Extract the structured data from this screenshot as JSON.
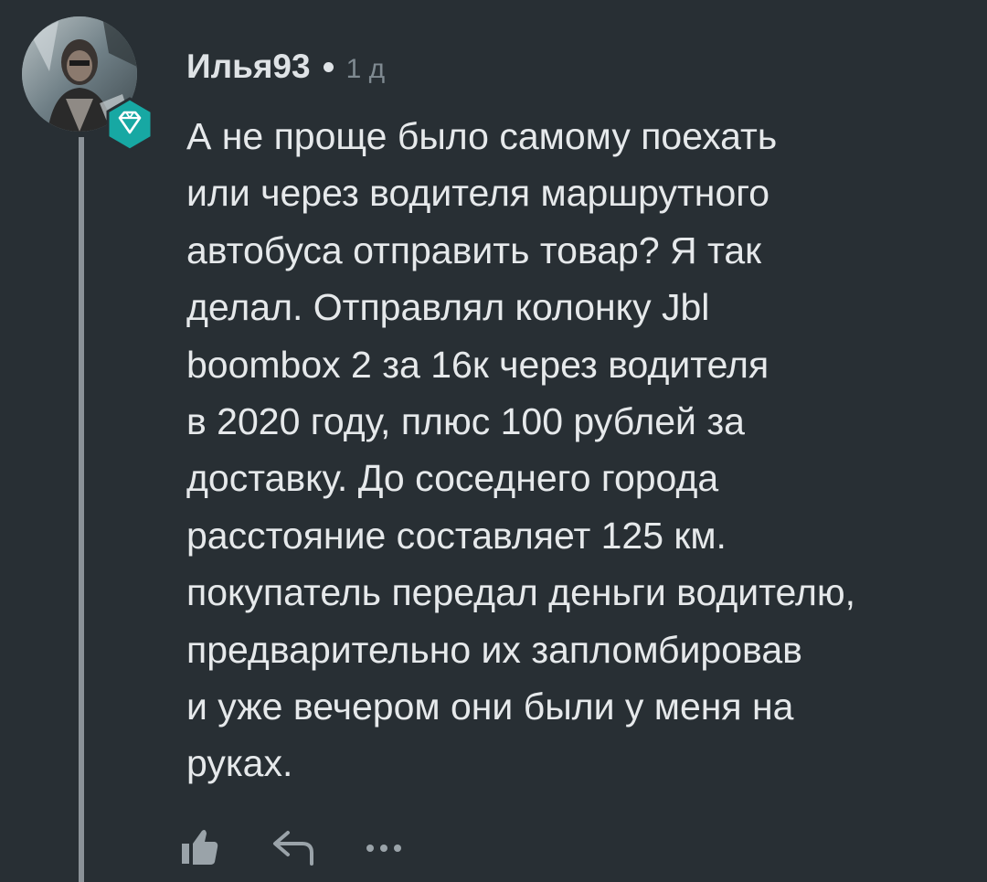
{
  "comment": {
    "author": "Илья93",
    "time": "1 д",
    "avatar": "user-avatar-photo",
    "badge": "diamond-badge-icon",
    "body_lines": [
      "А не проще было самому поехать",
      "или через водителя маршрутного",
      "автобуса отправить товар? Я так",
      "делал. Отправлял колонку Jbl",
      "boombox 2 за 16к через водителя",
      "в 2020 году, плюс 100 рублей за",
      "доставку. До соседнего города",
      "расстояние составляет 125 км.",
      "покупатель передал деньги водителю,",
      "предварительно их запломбировав",
      "и уже вечером они были у меня на",
      "руках."
    ],
    "actions": {
      "like": "thumbs-up-icon",
      "reply": "reply-arrow-icon",
      "more": "more-dots-icon"
    }
  },
  "colors": {
    "background": "#282f34",
    "text": "#e6e9eb",
    "muted": "#7f8a91",
    "badge": "#17a8a3",
    "thread_line": "#8a9197"
  }
}
